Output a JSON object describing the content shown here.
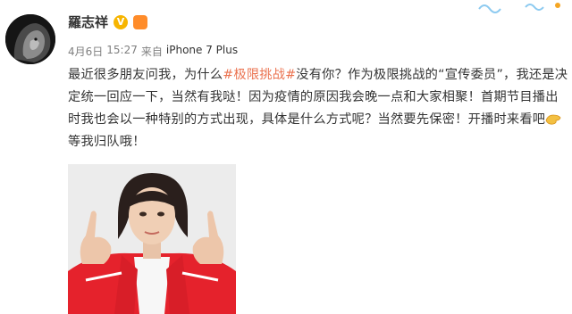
{
  "user": {
    "name": "羅志祥",
    "verified_icon": "gold-v-badge-icon",
    "vip_icon": "member-badge-icon"
  },
  "meta": {
    "date": "4月6日",
    "time": "15:27",
    "source_prefix": "来自",
    "source": "iPhone 7 Plus"
  },
  "post": {
    "line_a_before": "最近很多朋友问我，为什么",
    "topic": "#极限挑战#",
    "line_a_after": "没有你？作为极限挑战的“宣传委员”，我还是决定统一回应一下，当然有我哒！因为疫情的原因我会晚一点和大家相聚！首期节目播出时我也会以一种特别的方式出现，具体是什么方式呢？当然要先保密！开播时来看吧",
    "emoji_name": "come-here-hand-emoji-icon",
    "line_end": "等我归队哦！"
  },
  "colors": {
    "topic_link": "#eb7350",
    "meta_text": "#808080",
    "jacket_red": "#e5222c"
  }
}
